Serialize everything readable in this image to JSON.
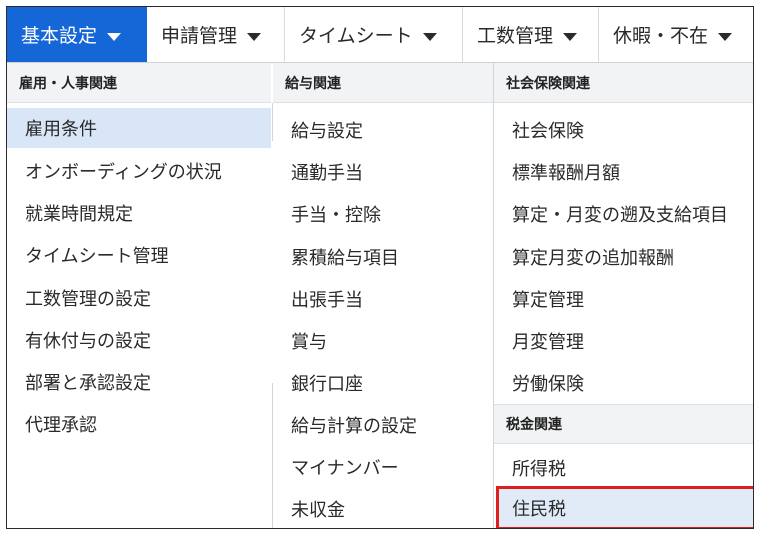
{
  "nav": {
    "items": [
      {
        "label": "基本設定"
      },
      {
        "label": "申請管理"
      },
      {
        "label": "タイムシート"
      },
      {
        "label": "工数管理"
      },
      {
        "label": "休暇・不在"
      }
    ]
  },
  "columns": {
    "employment": {
      "header": "雇用・人事関連",
      "items": [
        "雇用条件",
        "オンボーディングの状況",
        "就業時間規定",
        "タイムシート管理",
        "工数管理の設定",
        "有休付与の設定",
        "部署と承認設定",
        "代理承認"
      ]
    },
    "payroll": {
      "header": "給与関連",
      "items": [
        "給与設定",
        "通勤手当",
        "手当・控除",
        "累積給与項目",
        "出張手当",
        "賞与",
        "銀行口座",
        "給与計算の設定",
        "マイナンバー",
        "未収金"
      ]
    },
    "social_insurance": {
      "header": "社会保険関連",
      "items": [
        "社会保険",
        "標準報酬月額",
        "算定・月変の遡及支給項目",
        "算定月変の追加報酬",
        "算定管理",
        "月変管理",
        "労働保険"
      ]
    },
    "tax": {
      "header": "税金関連",
      "items": [
        "所得税",
        "住民税"
      ]
    }
  },
  "colors": {
    "active_nav": "#1566d6",
    "selected_row": "#d9e6f7",
    "highlight_border": "#e01e1e"
  }
}
